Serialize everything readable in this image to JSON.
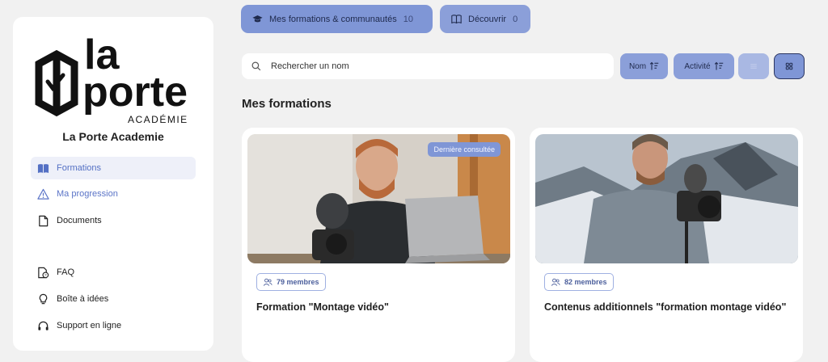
{
  "sidebar": {
    "logo_text_line1": "la",
    "logo_text_line2": "porte",
    "logo_text_line3": "ACADÉMIE",
    "brand_name": "La Porte Academie",
    "nav": [
      {
        "label": "Formations",
        "icon": "book-open-icon",
        "active": true
      },
      {
        "label": "Ma progression",
        "icon": "warning-triangle-icon",
        "active": false
      },
      {
        "label": "Documents",
        "icon": "document-icon",
        "active": false
      }
    ],
    "nav_bottom": [
      {
        "label": "FAQ",
        "icon": "faq-file-icon"
      },
      {
        "label": "Boîte à idées",
        "icon": "lightbulb-icon"
      },
      {
        "label": "Support en ligne",
        "icon": "headset-icon"
      }
    ]
  },
  "tabs": {
    "my_formations": {
      "label": "Mes formations & communautés",
      "count": "10",
      "icon": "graduation-cap-icon"
    },
    "discover": {
      "label": "Découvrir",
      "count": "0",
      "icon": "book-icon"
    }
  },
  "search": {
    "placeholder": "Rechercher un nom"
  },
  "sort": {
    "name_label": "Nom",
    "activity_label": "Activité"
  },
  "section_title": "Mes formations",
  "cards": [
    {
      "title": "Formation \"Montage vidéo\"",
      "members": "79 membres",
      "badge": "Dernière consultée"
    },
    {
      "title": "Contenus additionnels \"formation montage vidéo\"",
      "members": "82 membres"
    }
  ],
  "colors": {
    "accent": "#7f96d6",
    "accent_text": "#5470c4",
    "background": "#f1f1f1"
  }
}
